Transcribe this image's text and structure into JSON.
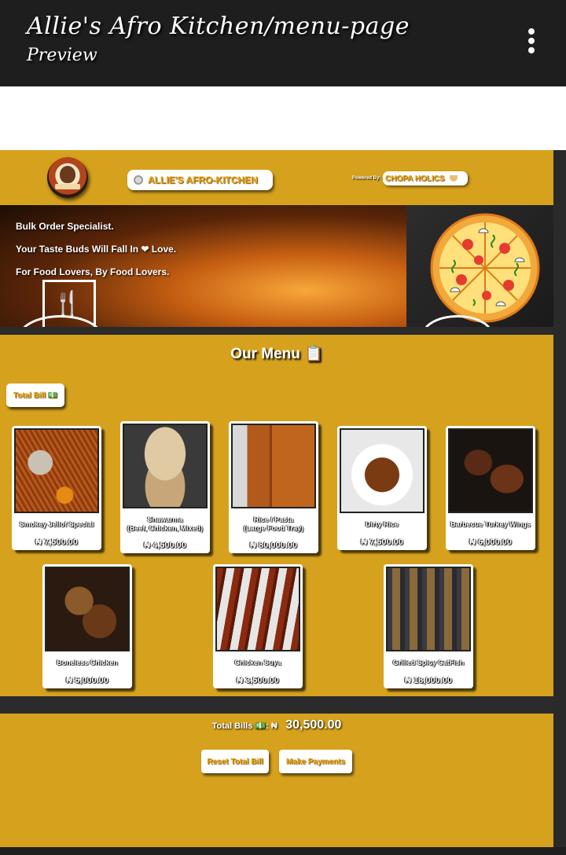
{
  "header": {
    "title": "Allie's Afro Kitchen/menu-page",
    "subtitle": "Preview",
    "menu_icon": "kebab-menu-icon"
  },
  "brand": {
    "logo_text": "ALLIE'S",
    "name": "ALLIE'S AFRO-KITCHEN",
    "powered_by_label": "Powered By:",
    "powered_by_name": "CHOPA HOLICS"
  },
  "hero": {
    "line1": "Bulk Order Specialist.",
    "line2": "Your Taste Buds Will Fall In ❤ Love.",
    "line3": "For Food Lovers, By Food Lovers."
  },
  "menu": {
    "title": "Our Menu 📋",
    "total_bill_button": "Total Bill 💵",
    "items": [
      {
        "name": "Smokey Jellof Special",
        "price": "₦ 7,500.00"
      },
      {
        "name": "Shawarma\n(Beef, Chicken, Mixed)",
        "price": "₦ 4,500.00"
      },
      {
        "name": "Rice / Pasta\n(Large Food Tray)",
        "price": "₦ 80,000.00"
      },
      {
        "name": "Dirty Rice",
        "price": "₦ 7,500.00"
      },
      {
        "name": "Barbecue Turkey Wings",
        "price": "₦ 6,000.00"
      },
      {
        "name": "Boneless Chicken",
        "price": "₦ 5,000.00"
      },
      {
        "name": "Chicken Suya",
        "price": "₦ 3,500.00"
      },
      {
        "name": "Grilled Spicy CatFish",
        "price": "₦ 18,000.00"
      }
    ]
  },
  "bills": {
    "label": "Total Bills 💵: ₦",
    "amount": "30,500.00",
    "reset_button": "Reset Total Bill",
    "pay_button": "Make Payments"
  },
  "colors": {
    "page_bg": "#d6a21d",
    "topbar": "#1e1e1e",
    "accent_text": "#e8a40e"
  }
}
